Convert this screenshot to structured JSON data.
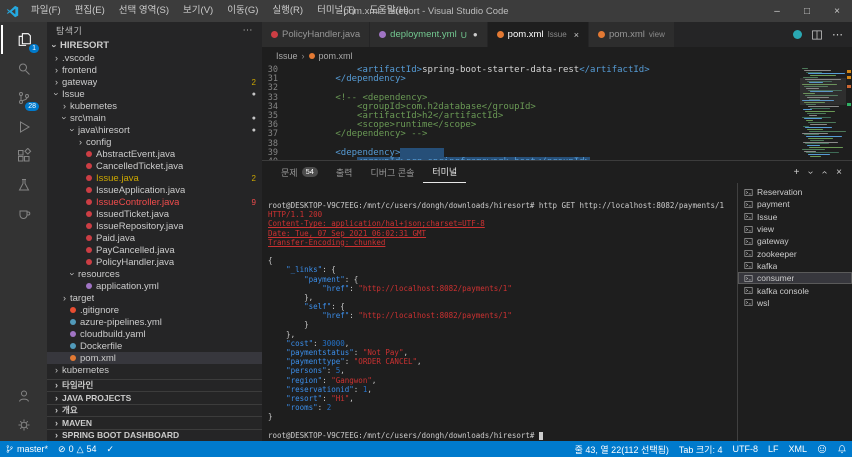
{
  "icons": {
    "chevron": "›",
    "more": "⋯",
    "kebab": "⋯",
    "minimize": "–",
    "maximize": "□",
    "close": "×",
    "add": "+",
    "error": "⊘",
    "warning": "△",
    "check": "✓",
    "modified_dot": "●"
  },
  "title_bar": {
    "title": "pom.xml - hiresort - Visual Studio Code",
    "menus": [
      "파일(F)",
      "편집(E)",
      "선택 영역(S)",
      "보기(V)",
      "이동(G)",
      "실행(R)",
      "터미널(T)",
      "도움말(H)"
    ]
  },
  "activity_bar": {
    "explorer_badge": "1",
    "scm_badge": "28"
  },
  "sidebar": {
    "title": "탐색기",
    "root_label": "HIRESORT",
    "tree": [
      {
        "l": ".vscode",
        "v": 0,
        "ch": "c"
      },
      {
        "l": "frontend",
        "v": 0,
        "ch": "c"
      },
      {
        "l": "gateway",
        "v": 0,
        "ch": "c",
        "b": "2"
      },
      {
        "l": "Issue",
        "v": 0,
        "ch": "o",
        "dot": true
      },
      {
        "l": "kubernetes",
        "v": 1,
        "ch": "c"
      },
      {
        "l": "src\\main",
        "v": 1,
        "ch": "o",
        "dot": true
      },
      {
        "l": "java\\hiresort",
        "v": 2,
        "ch": "o",
        "dot": true
      },
      {
        "l": "config",
        "v": 3,
        "ch": "c"
      },
      {
        "l": "AbstractEvent.java",
        "v": 3,
        "ic": "java"
      },
      {
        "l": "CancelledTicket.java",
        "v": 3,
        "ic": "java"
      },
      {
        "l": "Issue.java",
        "v": 3,
        "ic": "java",
        "b": "2",
        "col": "warn"
      },
      {
        "l": "IssueApplication.java",
        "v": 3,
        "ic": "java"
      },
      {
        "l": "IssueController.java",
        "v": 3,
        "ic": "java",
        "b": "9",
        "col": "err"
      },
      {
        "l": "IssuedTicket.java",
        "v": 3,
        "ic": "java"
      },
      {
        "l": "IssueRepository.java",
        "v": 3,
        "ic": "java"
      },
      {
        "l": "Paid.java",
        "v": 3,
        "ic": "java"
      },
      {
        "l": "PayCancelled.java",
        "v": 3,
        "ic": "java"
      },
      {
        "l": "PolicyHandler.java",
        "v": 3,
        "ic": "java"
      },
      {
        "l": "resources",
        "v": 2,
        "ch": "o"
      },
      {
        "l": "application.yml",
        "v": 3,
        "ic": "yml"
      },
      {
        "l": "target",
        "v": 1,
        "ch": "c"
      },
      {
        "l": ".gitignore",
        "v": 1,
        "ic": "git"
      },
      {
        "l": "azure-pipelines.yml",
        "v": 1,
        "ic": "azure"
      },
      {
        "l": "cloudbuild.yaml",
        "v": 1,
        "ic": "yml"
      },
      {
        "l": "Dockerfile",
        "v": 1,
        "ic": "docker"
      },
      {
        "l": "pom.xml",
        "v": 1,
        "ic": "xml",
        "sel": true
      },
      {
        "l": "kubernetes",
        "v": 0,
        "ch": "c"
      }
    ],
    "sections": [
      "타임라인",
      "JAVA PROJECTS",
      "개요",
      "MAVEN",
      "SPRING BOOT DASHBOARD"
    ]
  },
  "editor": {
    "tabs": [
      {
        "label": "PolicyHandler.java",
        "icon": "java",
        "state": "none"
      },
      {
        "label": "deployment.yml",
        "icon": "yml",
        "git": "U",
        "state": "modified"
      },
      {
        "label": "pom.xml",
        "hint": "Issue",
        "icon": "xml",
        "active": true,
        "state": "close"
      },
      {
        "label": "pom.xml",
        "hint": "view",
        "icon": "xml",
        "state": "none"
      }
    ],
    "breadcrumb": [
      "Issue",
      "pom.xml"
    ],
    "code_lines": [
      {
        "n": 30,
        "seg": [
          [
            "w",
            "            "
          ],
          [
            "g",
            "<artifactId>"
          ],
          [
            "w",
            "spring-boot-starter-data-rest"
          ],
          [
            "g",
            "</artifactId>"
          ]
        ]
      },
      {
        "n": 31,
        "seg": [
          [
            "w",
            "        "
          ],
          [
            "g",
            "</dependency>"
          ]
        ]
      },
      {
        "n": 32,
        "seg": []
      },
      {
        "n": 33,
        "seg": [
          [
            "w",
            "        "
          ],
          [
            "c",
            "<!-- <dependency>"
          ]
        ]
      },
      {
        "n": 34,
        "seg": [
          [
            "w",
            "            "
          ],
          [
            "c",
            "<groupId>com.h2database</groupId>"
          ]
        ]
      },
      {
        "n": 35,
        "seg": [
          [
            "w",
            "            "
          ],
          [
            "c",
            "<artifactId>h2</artifactId>"
          ]
        ]
      },
      {
        "n": 36,
        "seg": [
          [
            "w",
            "            "
          ],
          [
            "c",
            "<scope>runtime</scope>"
          ]
        ]
      },
      {
        "n": 37,
        "seg": [
          [
            "w",
            "        "
          ],
          [
            "c",
            "</dependency> -->"
          ]
        ]
      },
      {
        "n": 38,
        "seg": []
      },
      {
        "n": 39,
        "seg": [
          [
            "w",
            "        "
          ],
          [
            "g",
            "<dependency>"
          ],
          [
            "sel",
            "        "
          ]
        ]
      },
      {
        "n": 40,
        "seg": [
          [
            "w",
            "            "
          ],
          [
            "g sel",
            "<groupId>org.springframework.boot</groupId>"
          ]
        ]
      }
    ]
  },
  "panel": {
    "tabs": [
      {
        "label": "문제",
        "badge": "54"
      },
      {
        "label": "출력"
      },
      {
        "label": "디버그 콘솔"
      },
      {
        "label": "터미널",
        "active": true
      }
    ],
    "terminal_list": [
      {
        "label": "Reservation"
      },
      {
        "label": "payment"
      },
      {
        "label": "Issue"
      },
      {
        "label": "view"
      },
      {
        "label": "gateway"
      },
      {
        "label": "zookeeper"
      },
      {
        "label": "kafka"
      },
      {
        "label": "consumer",
        "active": true
      },
      {
        "label": "kafka console"
      },
      {
        "label": "wsl"
      }
    ],
    "terminal_lines": [
      {
        "s": [
          [
            "d",
            "root@DESKTOP-V9C7EEG:/mnt/c/users/dongh/downloads/hiresort# http GET http://localhost:8082/payments/1"
          ]
        ]
      },
      {
        "s": [
          [
            "h",
            "HTTP/1.1 200"
          ]
        ]
      },
      {
        "s": [
          [
            "hu",
            "Content-Type: application/hal+json;charset=UTF-8"
          ]
        ]
      },
      {
        "s": [
          [
            "hu",
            "Date: Tue, 07 Sep 2021 06:02:31 GMT"
          ]
        ]
      },
      {
        "s": [
          [
            "hu",
            "Transfer-Encoding: chunked"
          ]
        ]
      },
      {
        "s": []
      },
      {
        "s": [
          [
            "d",
            "{"
          ]
        ]
      },
      {
        "s": [
          [
            "d",
            "    "
          ],
          [
            "k",
            "\"_links\""
          ],
          [
            "d",
            ": {"
          ]
        ]
      },
      {
        "s": [
          [
            "d",
            "        "
          ],
          [
            "k",
            "\"payment\""
          ],
          [
            "d",
            ": {"
          ]
        ]
      },
      {
        "s": [
          [
            "d",
            "            "
          ],
          [
            "k",
            "\"href\""
          ],
          [
            "d",
            ": "
          ],
          [
            "s",
            "\"http://localhost:8082/payments/1\""
          ]
        ]
      },
      {
        "s": [
          [
            "d",
            "        },"
          ]
        ]
      },
      {
        "s": [
          [
            "d",
            "        "
          ],
          [
            "k",
            "\"self\""
          ],
          [
            "d",
            ": {"
          ]
        ]
      },
      {
        "s": [
          [
            "d",
            "            "
          ],
          [
            "k",
            "\"href\""
          ],
          [
            "d",
            ": "
          ],
          [
            "s",
            "\"http://localhost:8082/payments/1\""
          ]
        ]
      },
      {
        "s": [
          [
            "d",
            "        }"
          ]
        ]
      },
      {
        "s": [
          [
            "d",
            "    },"
          ]
        ]
      },
      {
        "s": [
          [
            "d",
            "    "
          ],
          [
            "k",
            "\"cost\""
          ],
          [
            "d",
            ": "
          ],
          [
            "n",
            "30000"
          ],
          [
            "d",
            ","
          ]
        ]
      },
      {
        "s": [
          [
            "d",
            "    "
          ],
          [
            "k",
            "\"paymentstatus\""
          ],
          [
            "d",
            ": "
          ],
          [
            "s",
            "\"Not Pay\""
          ],
          [
            "d",
            ","
          ]
        ]
      },
      {
        "s": [
          [
            "d",
            "    "
          ],
          [
            "k",
            "\"paymenttype\""
          ],
          [
            "d",
            ": "
          ],
          [
            "s",
            "\"ORDER CANCEL\""
          ],
          [
            "d",
            ","
          ]
        ]
      },
      {
        "s": [
          [
            "d",
            "    "
          ],
          [
            "k",
            "\"persons\""
          ],
          [
            "d",
            ": "
          ],
          [
            "n",
            "5"
          ],
          [
            "d",
            ","
          ]
        ]
      },
      {
        "s": [
          [
            "d",
            "    "
          ],
          [
            "k",
            "\"region\""
          ],
          [
            "d",
            ": "
          ],
          [
            "s",
            "\"Gangwon\""
          ],
          [
            "d",
            ","
          ]
        ]
      },
      {
        "s": [
          [
            "d",
            "    "
          ],
          [
            "k",
            "\"reservationid\""
          ],
          [
            "d",
            ": "
          ],
          [
            "n",
            "1"
          ],
          [
            "d",
            ","
          ]
        ]
      },
      {
        "s": [
          [
            "d",
            "    "
          ],
          [
            "k",
            "\"resort\""
          ],
          [
            "d",
            ": "
          ],
          [
            "s",
            "\"Hi\""
          ],
          [
            "d",
            ","
          ]
        ]
      },
      {
        "s": [
          [
            "d",
            "    "
          ],
          [
            "k",
            "\"rooms\""
          ],
          [
            "d",
            ": "
          ],
          [
            "n",
            "2"
          ]
        ]
      },
      {
        "s": [
          [
            "d",
            "}"
          ]
        ]
      },
      {
        "s": []
      },
      {
        "s": [
          [
            "d",
            "root@DESKTOP-V9C7EEG:/mnt/c/users/dongh/downloads/hiresort# "
          ]
        ],
        "cursor": true
      }
    ]
  },
  "status_bar": {
    "branch": "master*",
    "errors": "0",
    "warnings": "54",
    "selection": "줄 43, 열 22(112 선택됨)",
    "tab_size": "Tab 크기: 4",
    "encoding": "UTF-8",
    "eol": "LF",
    "language": "XML"
  }
}
